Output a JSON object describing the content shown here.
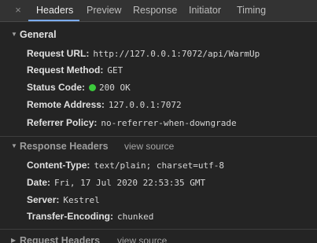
{
  "tabs": {
    "close_glyph": "×",
    "items": [
      {
        "label": "Headers",
        "active": true
      },
      {
        "label": "Preview"
      },
      {
        "label": "Response"
      },
      {
        "label": "Initiator"
      },
      {
        "label": "Timing"
      }
    ]
  },
  "general": {
    "title": "General",
    "request_url": {
      "key": "Request URL:",
      "value": "http://127.0.0.1:7072/api/WarmUp"
    },
    "request_method": {
      "key": "Request Method:",
      "value": "GET"
    },
    "status_code": {
      "key": "Status Code:",
      "value": "200 OK",
      "status_color": "#3cc93c"
    },
    "remote_address": {
      "key": "Remote Address:",
      "value": "127.0.0.1:7072"
    },
    "referrer_policy": {
      "key": "Referrer Policy:",
      "value": "no-referrer-when-downgrade"
    }
  },
  "response_headers": {
    "title": "Response Headers",
    "view_source": "view source",
    "content_type": {
      "key": "Content-Type:",
      "value": "text/plain; charset=utf-8"
    },
    "date": {
      "key": "Date:",
      "value": "Fri, 17 Jul 2020 22:53:35 GMT"
    },
    "server": {
      "key": "Server:",
      "value": "Kestrel"
    },
    "transfer_encoding": {
      "key": "Transfer-Encoding:",
      "value": "chunked"
    }
  },
  "request_headers": {
    "title": "Request Headers",
    "view_source": "view source"
  },
  "colors": {
    "accent": "#7cacf8",
    "background": "#242424",
    "tabbar": "#333333"
  },
  "icons": [
    "close-icon",
    "triangle-down-icon",
    "triangle-right-icon"
  ]
}
